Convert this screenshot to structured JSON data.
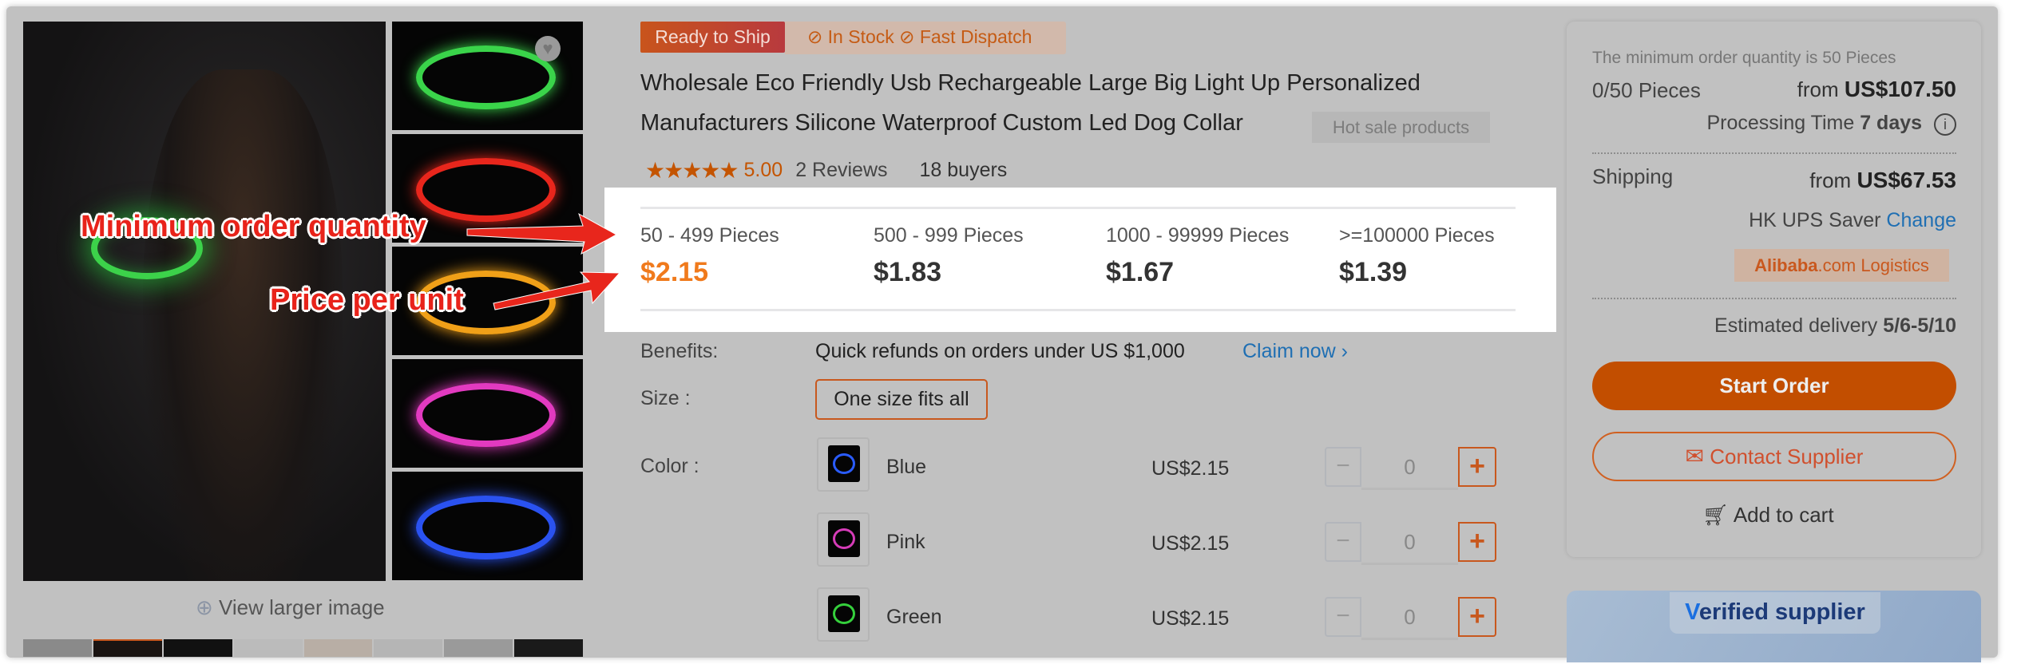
{
  "badges": {
    "ready": "Ready to Ship",
    "in_stock": "In Stock",
    "fast_dispatch": "Fast Dispatch"
  },
  "product": {
    "title_line1": "Wholesale Eco Friendly Usb Rechargeable Large Big Light Up Personalized",
    "title_line2": "Manufacturers Silicone Waterproof Custom Led Dog Collar",
    "hot_tag": "Hot sale products",
    "rating": "5.00",
    "stars": 5,
    "reviews": "2 Reviews",
    "buyers": "18 buyers"
  },
  "gallery": {
    "view_larger": "View larger image",
    "thumb_colors": [
      "#3ad44a",
      "#e8261c",
      "#f0a018",
      "#e23ac0",
      "#2a52f0"
    ]
  },
  "annotations": {
    "moq": "Minimum order quantity",
    "ppu": "Price per unit"
  },
  "tiers": [
    {
      "range": "50 - 499 Pieces",
      "price": "$2.15",
      "active": true
    },
    {
      "range": "500 - 999 Pieces",
      "price": "$1.83"
    },
    {
      "range": "1000 - 99999 Pieces",
      "price": "$1.67"
    },
    {
      "range": ">=100000 Pieces",
      "price": "$1.39"
    }
  ],
  "benefits": {
    "label": "Benefits:",
    "text": "Quick refunds on orders under US $1,000",
    "link": "Claim now"
  },
  "size": {
    "label": "Size :",
    "option": "One size fits all"
  },
  "color": {
    "label": "Color :",
    "options": [
      {
        "name": "Blue",
        "price": "US$2.15",
        "qty": "0",
        "swatch": "#2a5cff"
      },
      {
        "name": "Pink",
        "price": "US$2.15",
        "qty": "0",
        "swatch": "#d63cb8"
      },
      {
        "name": "Green",
        "price": "US$2.15",
        "qty": "0",
        "swatch": "#35d03c"
      }
    ]
  },
  "order": {
    "moq_note": "The minimum order quantity is 50 Pieces",
    "pieces": "0/50 Pieces",
    "from": "from",
    "total": "US$107.50",
    "processing": "Processing Time",
    "processing_days": "7 days",
    "shipping_label": "Shipping",
    "shipping_price": "US$67.53",
    "carrier": "HK UPS Saver",
    "change": "Change",
    "logistics_brand": "Alibaba",
    "logistics_suffix": ".com Logistics",
    "delivery_label": "Estimated delivery",
    "delivery_dates": "5/6-5/10",
    "start_order": "Start Order",
    "contact": "Contact Supplier",
    "add_cart": "Add to cart"
  },
  "verified": {
    "label_v": "V",
    "label_rest": "erified supplier"
  },
  "colors": {
    "accent": "#c24e00",
    "link": "#1f6fb3",
    "price_active": "#f07a1c"
  }
}
